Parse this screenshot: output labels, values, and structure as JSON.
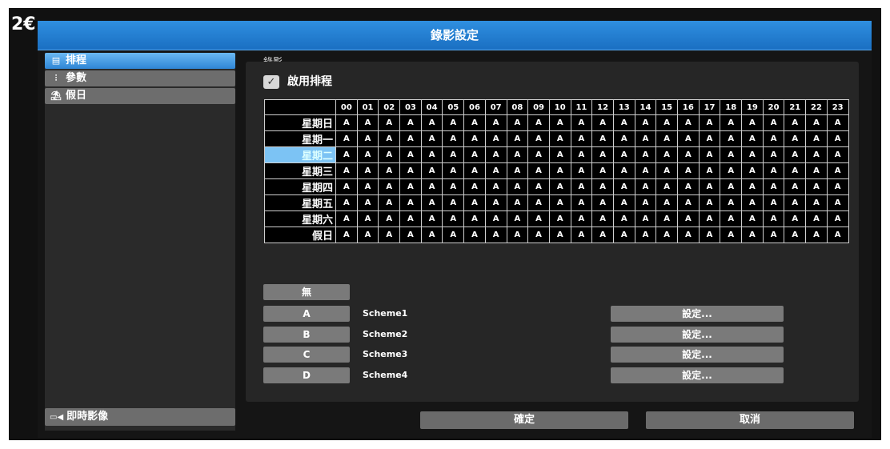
{
  "background": {
    "year_fragment": "2€"
  },
  "window": {
    "title": "錄影設定"
  },
  "sidebar": {
    "items": [
      {
        "label": "排程",
        "icon": "calendar-icon"
      },
      {
        "label": "參數",
        "icon": "sliders-icon"
      },
      {
        "label": "假日",
        "icon": "holiday-icon"
      }
    ],
    "live_view": {
      "label": "即時影像",
      "icon": "live-camera-icon"
    }
  },
  "main": {
    "section_link": "錄影",
    "enable_schedule": {
      "label": "啟用排程",
      "checked": true
    },
    "grid": {
      "hours": [
        "00",
        "01",
        "02",
        "03",
        "04",
        "05",
        "06",
        "07",
        "08",
        "09",
        "10",
        "11",
        "12",
        "13",
        "14",
        "15",
        "16",
        "17",
        "18",
        "19",
        "20",
        "21",
        "22",
        "23"
      ],
      "rows": [
        {
          "day": "星期日",
          "cells": [
            "A",
            "A",
            "A",
            "A",
            "A",
            "A",
            "A",
            "A",
            "A",
            "A",
            "A",
            "A",
            "A",
            "A",
            "A",
            "A",
            "A",
            "A",
            "A",
            "A",
            "A",
            "A",
            "A",
            "A"
          ]
        },
        {
          "day": "星期一",
          "cells": [
            "A",
            "A",
            "A",
            "A",
            "A",
            "A",
            "A",
            "A",
            "A",
            "A",
            "A",
            "A",
            "A",
            "A",
            "A",
            "A",
            "A",
            "A",
            "A",
            "A",
            "A",
            "A",
            "A",
            "A"
          ]
        },
        {
          "day": "星期二",
          "cells": [
            "A",
            "A",
            "A",
            "A",
            "A",
            "A",
            "A",
            "A",
            "A",
            "A",
            "A",
            "A",
            "A",
            "A",
            "A",
            "A",
            "A",
            "A",
            "A",
            "A",
            "A",
            "A",
            "A",
            "A"
          ]
        },
        {
          "day": "星期三",
          "cells": [
            "A",
            "A",
            "A",
            "A",
            "A",
            "A",
            "A",
            "A",
            "A",
            "A",
            "A",
            "A",
            "A",
            "A",
            "A",
            "A",
            "A",
            "A",
            "A",
            "A",
            "A",
            "A",
            "A",
            "A"
          ]
        },
        {
          "day": "星期四",
          "cells": [
            "A",
            "A",
            "A",
            "A",
            "A",
            "A",
            "A",
            "A",
            "A",
            "A",
            "A",
            "A",
            "A",
            "A",
            "A",
            "A",
            "A",
            "A",
            "A",
            "A",
            "A",
            "A",
            "A",
            "A"
          ]
        },
        {
          "day": "星期五",
          "cells": [
            "A",
            "A",
            "A",
            "A",
            "A",
            "A",
            "A",
            "A",
            "A",
            "A",
            "A",
            "A",
            "A",
            "A",
            "A",
            "A",
            "A",
            "A",
            "A",
            "A",
            "A",
            "A",
            "A",
            "A"
          ]
        },
        {
          "day": "星期六",
          "cells": [
            "A",
            "A",
            "A",
            "A",
            "A",
            "A",
            "A",
            "A",
            "A",
            "A",
            "A",
            "A",
            "A",
            "A",
            "A",
            "A",
            "A",
            "A",
            "A",
            "A",
            "A",
            "A",
            "A",
            "A"
          ]
        },
        {
          "day": "假日",
          "cells": [
            "A",
            "A",
            "A",
            "A",
            "A",
            "A",
            "A",
            "A",
            "A",
            "A",
            "A",
            "A",
            "A",
            "A",
            "A",
            "A",
            "A",
            "A",
            "A",
            "A",
            "A",
            "A",
            "A",
            "A"
          ]
        }
      ],
      "selected_day": "星期二"
    },
    "none_button": "無",
    "schemes": [
      {
        "key": "A",
        "name": "Scheme1",
        "settings_label": "設定..."
      },
      {
        "key": "B",
        "name": "Scheme2",
        "settings_label": "設定..."
      },
      {
        "key": "C",
        "name": "Scheme3",
        "settings_label": "設定..."
      },
      {
        "key": "D",
        "name": "Scheme4",
        "settings_label": "設定..."
      }
    ]
  },
  "footer": {
    "ok_label": "確定",
    "cancel_label": "取消"
  },
  "colors": {
    "title_bar": "#2a82d4",
    "selected": "#7cc3f4",
    "button": "#7a7a7a",
    "panel": "#262626"
  }
}
